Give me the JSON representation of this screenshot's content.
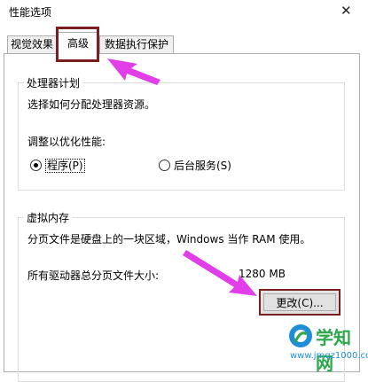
{
  "window": {
    "title": "性能选项",
    "close_glyph": "✕"
  },
  "tabs": [
    {
      "label": "视觉效果",
      "active": false
    },
    {
      "label": "高级",
      "active": true
    },
    {
      "label": "数据执行保护",
      "active": false
    }
  ],
  "processor_scheduling": {
    "legend": "处理器计划",
    "description": "选择如何分配处理器资源。",
    "adjust_label": "调整以优化性能:",
    "options": [
      {
        "label": "程序(P)",
        "checked": true
      },
      {
        "label": "后台服务(S)",
        "checked": false
      }
    ]
  },
  "virtual_memory": {
    "legend": "虚拟内存",
    "description": "分页文件是硬盘上的一块区域，Windows 当作 RAM 使用。",
    "total_label": "所有驱动器总分页文件大小:",
    "total_value": "1280 MB",
    "change_button": "更改(C)..."
  },
  "annotations": {
    "highlight_color": "#7a1f1f",
    "arrow_color": "#e23ee8"
  },
  "watermark": {
    "title": "学知网",
    "url": "www.jmqz1000.com"
  }
}
